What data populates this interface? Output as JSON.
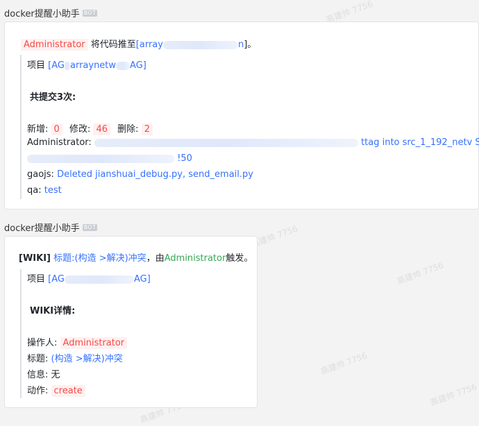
{
  "messages": [
    {
      "sender": "docker提醒小助手",
      "badge": "BOT",
      "header": {
        "actor": "Administrator",
        "text": "将代码推至",
        "bracket_open": "[",
        "repo_prefix": "array",
        "repo_suffix": "n",
        "bracket_close": "]。"
      },
      "project_label": "项目",
      "project_open": "[",
      "project_prefix": "AG",
      "project_mid": "arraynetw",
      "project_suffix": "AG",
      "project_close": "]",
      "title": "共提交3次:",
      "stats": {
        "added_label": "新增:",
        "added": "0",
        "modified_label": "修改:",
        "modified": "46",
        "deleted_label": "删除:",
        "deleted": "2"
      },
      "commits": [
        {
          "author": "Administrator:",
          "text": "ttag into src_1_192_netv S",
          "cont": "!50"
        },
        {
          "author": "gaojs:",
          "text": "Deleted jianshuai_debug.py, send_email.py"
        },
        {
          "author": "qa:",
          "text": "test"
        }
      ]
    },
    {
      "sender": "docker提醒小助手",
      "badge": "BOT",
      "header": {
        "tag": "[WIKI]",
        "title_link": "标题:(构造 >解决)冲突",
        "by": "，由",
        "actor": "Administrator",
        "trigger": "触发。"
      },
      "project_label": "项目",
      "project_open": "[",
      "project_prefix": "AG",
      "project_suffix": "AG",
      "project_close": "]",
      "title": "WIKI详情:",
      "details": {
        "operator_label": "操作人:",
        "operator": "Administrator",
        "title_label": "标题:",
        "title_value": "(构造 >解决)冲突",
        "info_label": "信息:",
        "info_value": "无",
        "action_label": "动作:",
        "action_value": "create"
      }
    }
  ],
  "watermark": "高建帅 7756"
}
